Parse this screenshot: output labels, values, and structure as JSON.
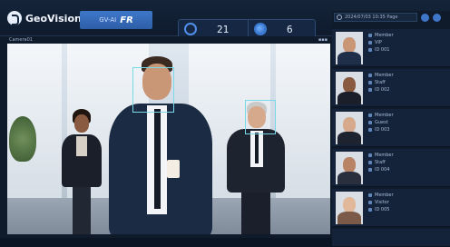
{
  "brand": {
    "name": "GeoVision"
  },
  "app": {
    "badge_small": "GV-AI",
    "badge_large": "FR"
  },
  "counters": [
    {
      "icon": "face-icon",
      "value": "21"
    },
    {
      "icon": "globe-icon",
      "value": "6"
    }
  ],
  "video": {
    "label": "Camera01",
    "corner": "▪▪▪"
  },
  "panel": {
    "search_placeholder": "2024/07/03 10:35 Page",
    "cards": [
      {
        "name": "Member",
        "group": "VIP",
        "id": "ID 001"
      },
      {
        "name": "Member",
        "group": "Staff",
        "id": "ID 002"
      },
      {
        "name": "Member",
        "group": "Guest",
        "id": "ID 003"
      },
      {
        "name": "Member",
        "group": "Staff",
        "id": "ID 004"
      },
      {
        "name": "Member",
        "group": "Visitor",
        "id": "ID 005"
      }
    ]
  },
  "colors": {
    "accent": "#3f78c9",
    "face_box": "#7ad9e6",
    "bg": "#0f1a2b"
  }
}
